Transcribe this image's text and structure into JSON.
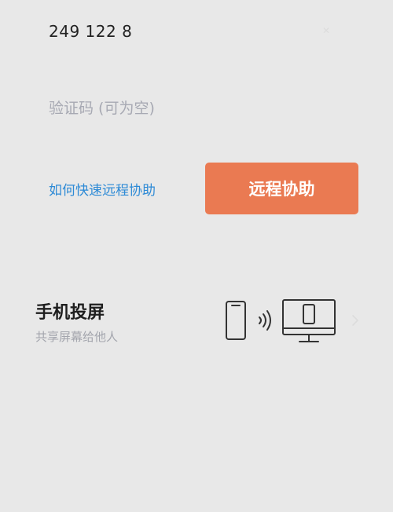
{
  "remote": {
    "device_id": "249 122 8",
    "code_placeholder": "验证码 (可为空)",
    "help_link": "如何快速远程协助",
    "assist_button": "远程协助"
  },
  "cast": {
    "title": "手机投屏",
    "subtitle": "共享屏幕给他人"
  },
  "icons": {
    "clear": "close-icon",
    "illustration": "phone-to-monitor-cast-icon",
    "chevron": "chevron-right-icon"
  },
  "colors": {
    "background": "#e8e8e8",
    "accent_button": "#ea7a52",
    "link": "#2d8ad6",
    "placeholder": "#a7a9b3"
  }
}
